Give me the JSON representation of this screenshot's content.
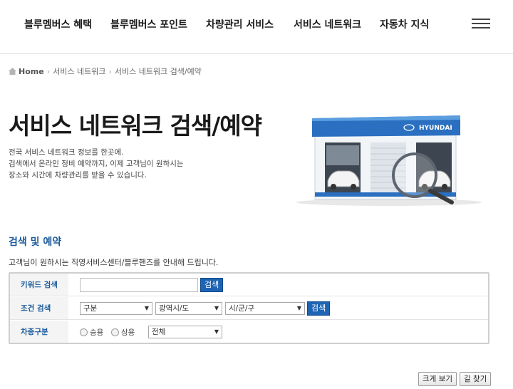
{
  "nav": {
    "items": [
      "블루멤버스 혜택",
      "블루멤버스 포인트",
      "차량관리 서비스",
      "서비스 네트워크",
      "자동차 지식"
    ]
  },
  "breadcrumb": {
    "home": "Home",
    "level1": "서비스 네트워크",
    "level2": "서비스 네트워크 검색/예약"
  },
  "hero": {
    "title": "서비스 네트워크 검색/예약",
    "desc": [
      "전국 서비스 네트워크 정보를 한곳에.",
      "검색에서 온라인 정비 예약까지, 이제 고객님이 원하시는",
      "장소와 시간에 차량관리를 받을 수 있습니다."
    ],
    "brand": "HYUNDAI"
  },
  "search": {
    "section_title": "검색 및 예약",
    "section_desc": "고객님이 원하시는 직영서비스센터/블루핸즈를 안내해 드립니다.",
    "keyword_label": "키워드 검색",
    "keyword_value": "",
    "keyword_button": "검색",
    "condition_label": "조건 검색",
    "select_type": "구분",
    "select_region": "광역시/도",
    "select_city": "시/군/구",
    "condition_button": "검색",
    "vehicle_label": "차종구분",
    "radio_passenger": "승용",
    "radio_commercial": "상용",
    "select_vehicle": "전체"
  },
  "buttons": {
    "large_view": "크게 보기",
    "directions": "길 찾기"
  },
  "colors": {
    "accent": "#1b5a9a",
    "button_blue": "#1e64b4"
  }
}
